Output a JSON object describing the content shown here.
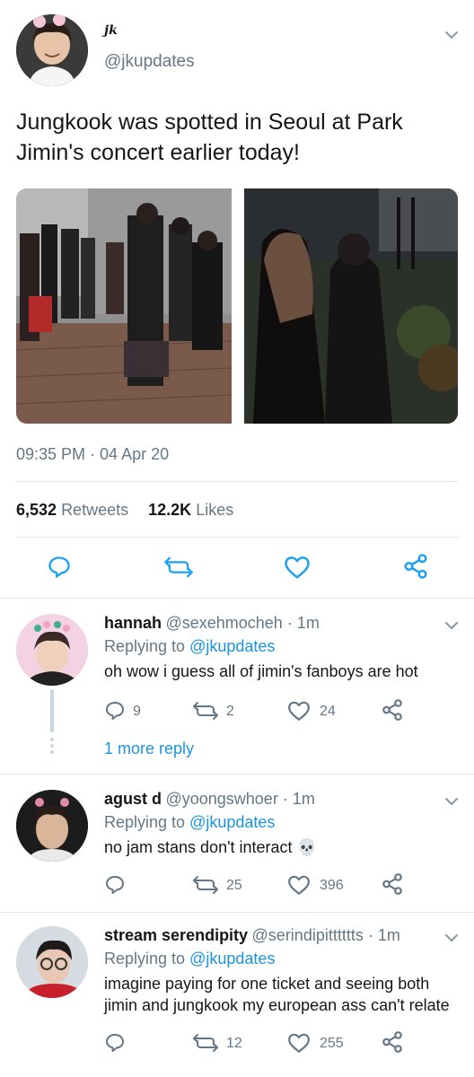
{
  "main_tweet": {
    "display_name": "jk",
    "handle": "@jkupdates",
    "text_line1": "Jungkook was spotted in Seoul at Park",
    "text_line2": "Jimin's concert earlier today!",
    "timestamp": "09:35 PM · 04 Apr 20",
    "retweets_count": "6,532",
    "retweets_label": "Retweets",
    "likes_count": "12.2K",
    "likes_label": "Likes"
  },
  "replies": [
    {
      "name": "hannah",
      "handle": "@sexehmocheh · 1m",
      "replying_prefix": "Replying to",
      "replying_to": "@jkupdates",
      "text": "oh wow i guess all of jimin's fanboys are hot",
      "reply_count": "9",
      "retweet_count": "2",
      "like_count": "24",
      "more_replies": "1 more reply"
    },
    {
      "name": "agust d",
      "handle": "@yoongswhoer · 1m",
      "replying_prefix": "Replying to",
      "replying_to": "@jkupdates",
      "text": "no jam stans don't interact 💀",
      "retweet_count": "25",
      "like_count": "396"
    },
    {
      "name": "stream serendipity",
      "handle": "@serindipitttttts · 1m",
      "replying_prefix": "Replying to",
      "replying_to": "@jkupdates",
      "text_line1": "imagine paying for one ticket and seeing both",
      "text_line2": "jimin and jungkook my european ass can't relate",
      "retweet_count": "12",
      "like_count": "255"
    }
  ],
  "colors": {
    "link_blue": "#1b95e0",
    "secondary_gray": "#657786",
    "divider": "#e1e8ed"
  }
}
